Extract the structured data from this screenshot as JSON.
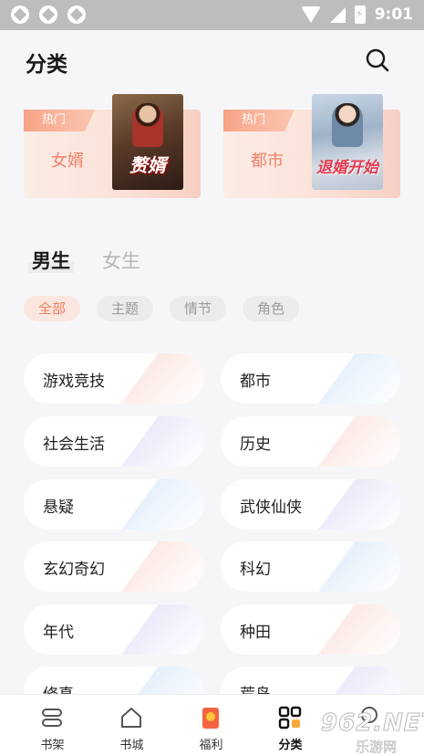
{
  "status_bar": {
    "time": "9:01"
  },
  "header": {
    "title": "分类",
    "search_icon": "search-icon"
  },
  "hot_cards": [
    {
      "badge": "热门",
      "name": "女婿",
      "cover_title": "赘婿"
    },
    {
      "badge": "热门",
      "name": "都市",
      "cover_title": "退婚开始"
    }
  ],
  "gender_tabs": [
    {
      "label": "男生",
      "active": true
    },
    {
      "label": "女生",
      "active": false
    }
  ],
  "filter_chips": [
    {
      "label": "全部",
      "active": true
    },
    {
      "label": "主题",
      "active": false
    },
    {
      "label": "情节",
      "active": false
    },
    {
      "label": "角色",
      "active": false
    }
  ],
  "categories": [
    {
      "label": "游戏竞技",
      "accent": "#fbe1dc"
    },
    {
      "label": "都市",
      "accent": "#dcebfb"
    },
    {
      "label": "社会生活",
      "accent": "#e6e0f8"
    },
    {
      "label": "历史",
      "accent": "#fbe1dc"
    },
    {
      "label": "悬疑",
      "accent": "#dcebfb"
    },
    {
      "label": "武侠仙侠",
      "accent": "#e6e0f8"
    },
    {
      "label": "玄幻奇幻",
      "accent": "#fbe1dc"
    },
    {
      "label": "科幻",
      "accent": "#dcebfb"
    },
    {
      "label": "年代",
      "accent": "#e6e0f8"
    },
    {
      "label": "种田",
      "accent": "#fbe1dc"
    },
    {
      "label": "修真",
      "accent": "#dcebfb"
    },
    {
      "label": "荒岛",
      "accent": "#e6e0f8"
    }
  ],
  "tab_bar": [
    {
      "label": "书架",
      "icon": "bookshelf-icon"
    },
    {
      "label": "书城",
      "icon": "home-icon"
    },
    {
      "label": "福利",
      "icon": "gift-icon"
    },
    {
      "label": "分类",
      "icon": "category-grid-icon",
      "active": true
    },
    {
      "label": "我的",
      "icon": "profile-icon"
    }
  ],
  "watermark": {
    "text": "962.NET",
    "sub": "乐游网"
  },
  "colors": {
    "accent": "#f07f5c",
    "badge": "#f8a486",
    "hot_text": "#f0826a"
  }
}
